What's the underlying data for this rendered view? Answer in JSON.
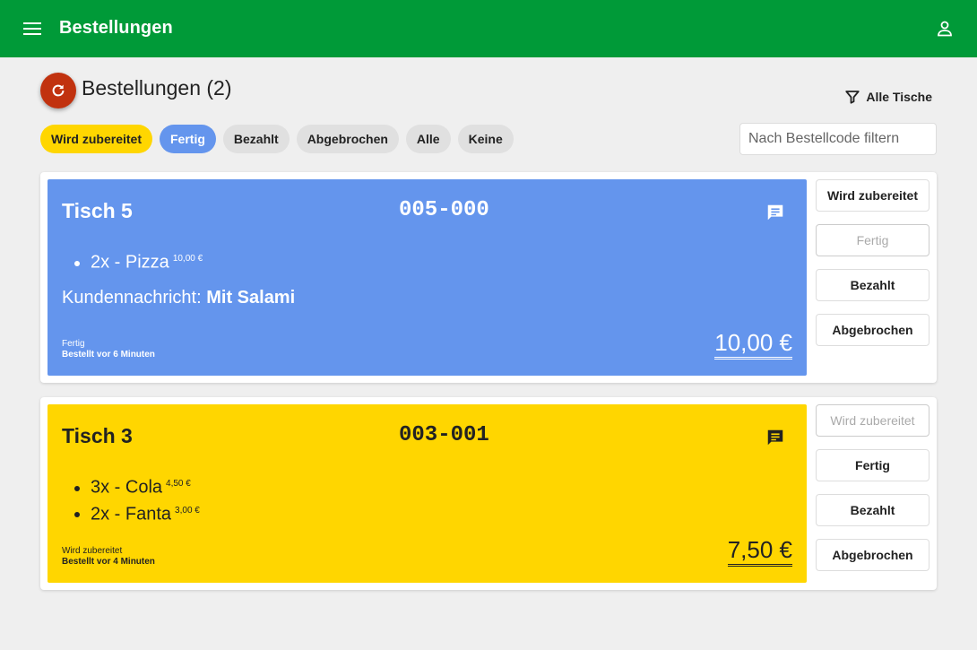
{
  "app": {
    "title": "Bestellungen",
    "menu_icon": "menu-icon",
    "account_icon": "account-icon",
    "brand_color": "#009a38"
  },
  "header": {
    "title": "Bestellungen (2)",
    "refresh_icon": "refresh-icon",
    "table_filter_label": "Alle Tische",
    "table_filter_icon": "filter-icon"
  },
  "status_filters": [
    {
      "label": "Wird zubereitet",
      "color": "#ffd600"
    },
    {
      "label": "Fertig",
      "color": "#6495ed"
    },
    {
      "label": "Bezahlt",
      "color": "#e0e0e0"
    },
    {
      "label": "Abgebrochen",
      "color": "#e0e0e0"
    },
    {
      "label": "Alle",
      "color": "#e0e0e0"
    },
    {
      "label": "Keine",
      "color": "#e0e0e0"
    }
  ],
  "search": {
    "placeholder": "Nach Bestellcode filtern",
    "value": ""
  },
  "orders": [
    {
      "table": "Tisch 5",
      "code": "005-000",
      "color": "#6495ed",
      "items": [
        {
          "text": "2x - Pizza",
          "price": "10,00 €"
        }
      ],
      "message_label": "Kundennachricht:",
      "message": "Mit Salami",
      "status": "Fertig",
      "ordered": "Bestellt vor 6 Minuten",
      "total": "10,00 €",
      "actions": [
        {
          "label": "Wird zubereitet",
          "disabled": false
        },
        {
          "label": "Fertig",
          "disabled": true
        },
        {
          "label": "Bezahlt",
          "disabled": false
        },
        {
          "label": "Abgebrochen",
          "disabled": false
        }
      ]
    },
    {
      "table": "Tisch 3",
      "code": "003-001",
      "color": "#ffd600",
      "items": [
        {
          "text": "3x - Cola",
          "price": "4,50 €"
        },
        {
          "text": "2x - Fanta",
          "price": "3,00 €"
        }
      ],
      "status": "Wird zubereitet",
      "ordered": "Bestellt vor 4 Minuten",
      "total": "7,50 €",
      "actions": [
        {
          "label": "Wird zubereitet",
          "disabled": true
        },
        {
          "label": "Fertig",
          "disabled": false
        },
        {
          "label": "Bezahlt",
          "disabled": false
        },
        {
          "label": "Abgebrochen",
          "disabled": false
        }
      ]
    }
  ]
}
